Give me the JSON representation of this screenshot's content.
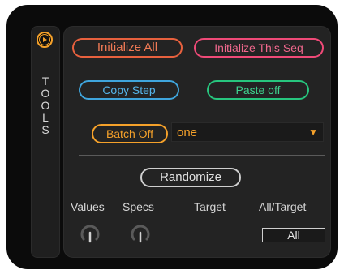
{
  "sidebar": {
    "title_letters": [
      "T",
      "O",
      "O",
      "L",
      "S"
    ]
  },
  "buttons": {
    "initialize_all": "Initialize All",
    "initialize_this_seq": "Initialize This Seq",
    "copy_step": "Copy Step",
    "paste": "Paste off",
    "batch": "Batch Off",
    "randomize": "Randomize"
  },
  "dropdown": {
    "selected": "one",
    "arrow_icon": "triangle-down"
  },
  "labels": {
    "values": "Values",
    "specs": "Specs",
    "target": "Target",
    "all_target": "All/Target"
  },
  "selector": {
    "value": "All"
  },
  "colors": {
    "accent_orange": "#f5a12a",
    "initialize_all": "#e8613e",
    "initialize_seq": "#f04a78",
    "copy": "#3fa5dc",
    "paste": "#27c67e"
  }
}
